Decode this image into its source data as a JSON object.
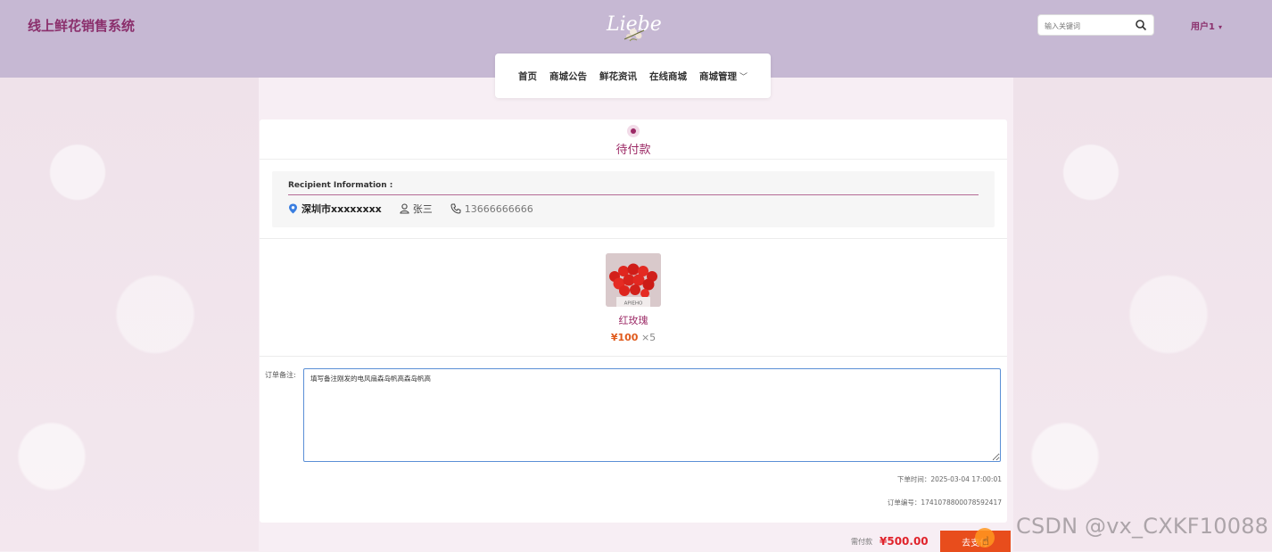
{
  "header": {
    "site_title": "线上鲜花销售系统",
    "logo_text": "Liebe",
    "search_placeholder": "输入关键词",
    "user_menu": "用户1"
  },
  "nav": {
    "items": [
      {
        "label": "首页"
      },
      {
        "label": "商城公告"
      },
      {
        "label": "鲜花资讯"
      },
      {
        "label": "在线商城"
      },
      {
        "label": "商城管理"
      }
    ]
  },
  "order": {
    "status": "待付款",
    "recipient_label": "Recipient Information :",
    "address": "深圳市xxxxxxxx",
    "recipient_name": "张三",
    "phone": "13666666666",
    "product": {
      "image_caption": "APIEHO",
      "name": "红玫瑰",
      "price": "¥100",
      "qty": "×5"
    },
    "remark_label": "订单备注:",
    "remark_value": "填写备注刚发的电风扇森岛帆高森岛帆高",
    "order_time": "下单时间：2025-03-04 17:00:01",
    "order_no": "订单编号：1741078800078592417",
    "pay_label": "需付款",
    "pay_amount": "¥500.00",
    "pay_button": "去支付"
  },
  "watermark": "CSDN @vx_CXKF10088",
  "colors": {
    "header_bg": "#c6b8d3",
    "brand": "#8b2f6c",
    "status": "#9c2a66",
    "price": "#e05a1c",
    "pay_button": "#e84d1c"
  }
}
